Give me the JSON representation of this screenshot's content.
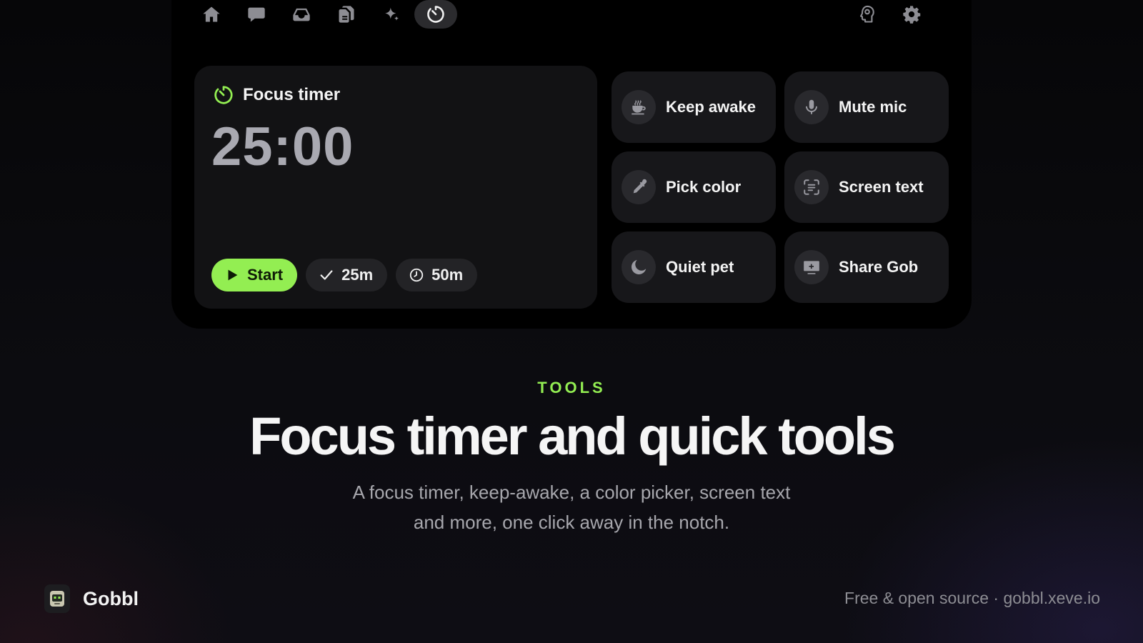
{
  "nav": {
    "items": [
      {
        "icon": "home-icon"
      },
      {
        "icon": "chat-bubble-icon"
      },
      {
        "icon": "inbox-tray-icon"
      },
      {
        "icon": "clipboard-files-icon"
      },
      {
        "icon": "sparkles-icon"
      },
      {
        "icon": "timer-icon",
        "active": true
      }
    ],
    "right_items": [
      {
        "icon": "brain-head-icon"
      },
      {
        "icon": "gear-icon"
      }
    ]
  },
  "timer": {
    "title": "Focus timer",
    "time": "25:00",
    "start_label": "Start",
    "preset_a_label": "25m",
    "preset_b_label": "50m",
    "accent_color": "#93ee52"
  },
  "tools": [
    {
      "label": "Keep awake",
      "icon": "coffee-cup-icon"
    },
    {
      "label": "Mute mic",
      "icon": "microphone-icon"
    },
    {
      "label": "Pick color",
      "icon": "eyedropper-icon"
    },
    {
      "label": "Screen text",
      "icon": "text-scan-icon"
    },
    {
      "label": "Quiet pet",
      "icon": "moon-icon"
    },
    {
      "label": "Share Gob",
      "icon": "screen-share-icon"
    }
  ],
  "hero": {
    "eyebrow": "TOOLS",
    "headline": "Focus timer and quick tools",
    "subline": "A focus timer, keep-awake, a color picker, screen text and more, one click away in the notch."
  },
  "footer": {
    "brand_name": "Gobbl",
    "right_text": "Free & open source · gobbl.xeve.io"
  }
}
